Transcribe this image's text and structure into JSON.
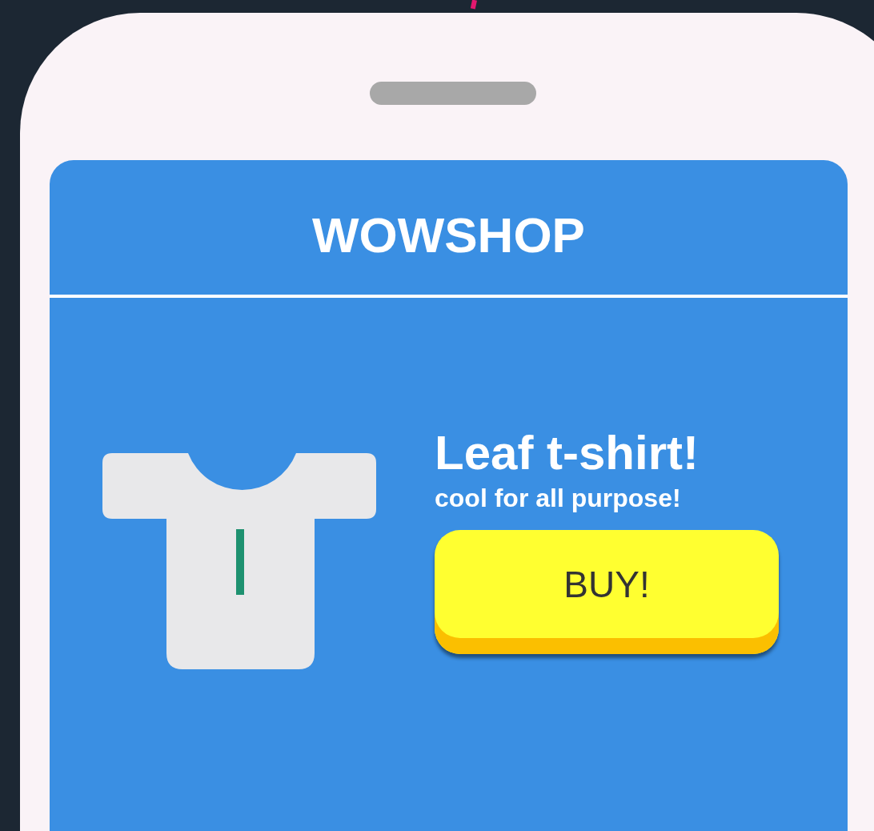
{
  "header": {
    "title": "WOWSHOP"
  },
  "product": {
    "name": "Leaf t-shirt!",
    "tagline": "cool for all purpose!",
    "button": "BUY!"
  }
}
